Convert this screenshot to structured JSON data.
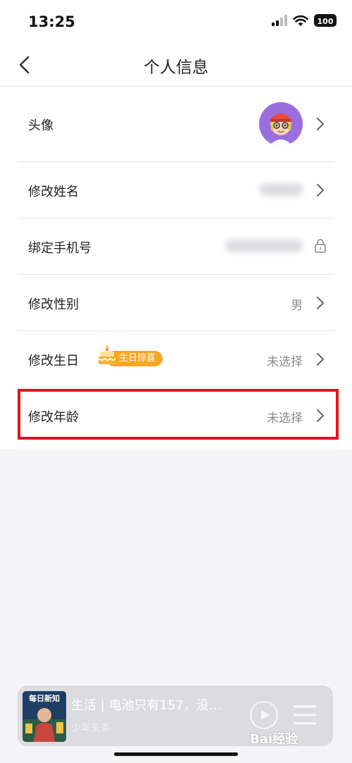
{
  "status_bar": {
    "time": "13:25",
    "battery": "100"
  },
  "nav": {
    "title": "个人信息"
  },
  "rows": {
    "avatar": {
      "label": "头像"
    },
    "name": {
      "label": "修改姓名"
    },
    "phone": {
      "label": "绑定手机号"
    },
    "gender": {
      "label": "修改性别",
      "value": "男"
    },
    "birthday": {
      "label": "修改生日",
      "badge": "生日惊喜",
      "value": "未选择"
    },
    "age": {
      "label": "修改年龄",
      "value": "未选择"
    }
  },
  "player": {
    "cover_text": "每日新知",
    "title": "生活 | 电池只有157，没…",
    "subtitle": "少年头条"
  },
  "watermark": "Bai经验",
  "colors": {
    "highlight": "#e0141d",
    "badge": "#f5a623",
    "avatar_bg": "#9b6ee0"
  }
}
